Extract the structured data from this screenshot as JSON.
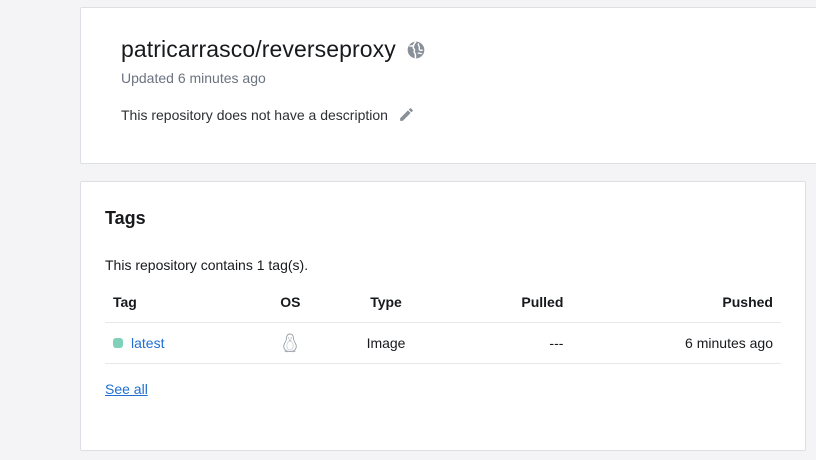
{
  "repository": {
    "name": "patricarrasco/reverseproxy",
    "visibility_icon": "globe-icon",
    "updated": "Updated 6 minutes ago",
    "description": "This repository does not have a description",
    "edit_icon": "pencil-icon"
  },
  "tags": {
    "heading": "Tags",
    "count_text": "This repository contains 1 tag(s).",
    "columns": {
      "tag": "Tag",
      "os": "OS",
      "type": "Type",
      "pulled": "Pulled",
      "pushed": "Pushed"
    },
    "rows": [
      {
        "tag": "latest",
        "status_color": "#7fd1b9",
        "os_icon": "linux-icon",
        "type": "Image",
        "pulled": "---",
        "pushed": "6 minutes ago"
      }
    ],
    "see_all": "See all"
  },
  "colors": {
    "link": "#1f6fd1",
    "muted_text": "#6b7380",
    "icon_gray": "#8a9099"
  }
}
